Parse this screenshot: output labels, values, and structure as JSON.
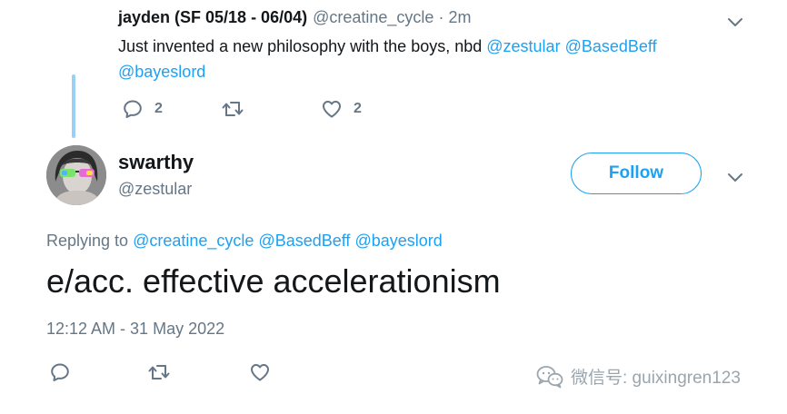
{
  "parent_tweet": {
    "display_name": "jayden (SF 05/18 - 06/04)",
    "handle": "@creatine_cycle",
    "separator": "·",
    "time": "2m",
    "text": "Just invented a new philosophy with the boys, nbd ",
    "mentions": [
      "@zestular",
      "@BasedBeff",
      "@bayeslord"
    ],
    "reply_count": "2",
    "like_count": "2"
  },
  "main_tweet": {
    "display_name": "swarthy",
    "handle": "@zestular",
    "follow_label": "Follow",
    "replying_prefix": "Replying to ",
    "replying_mentions": [
      "@creatine_cycle",
      "@BasedBeff",
      "@bayeslord"
    ],
    "text": "e/acc. effective accelerationism",
    "timestamp": "12:12 AM - 31 May 2022"
  },
  "watermark": {
    "text": "微信号: guixingren123"
  },
  "colors": {
    "accent": "#1da1f2",
    "secondary_text": "#657786",
    "primary_text": "#14171a",
    "thread_line": "#9ad0f5"
  },
  "icons": {
    "reply": "comment-bubble-icon",
    "retweet": "retweet-arrows-icon",
    "like": "heart-icon",
    "caret": "chevron-down-icon",
    "watermark": "wechat-logo-icon"
  }
}
